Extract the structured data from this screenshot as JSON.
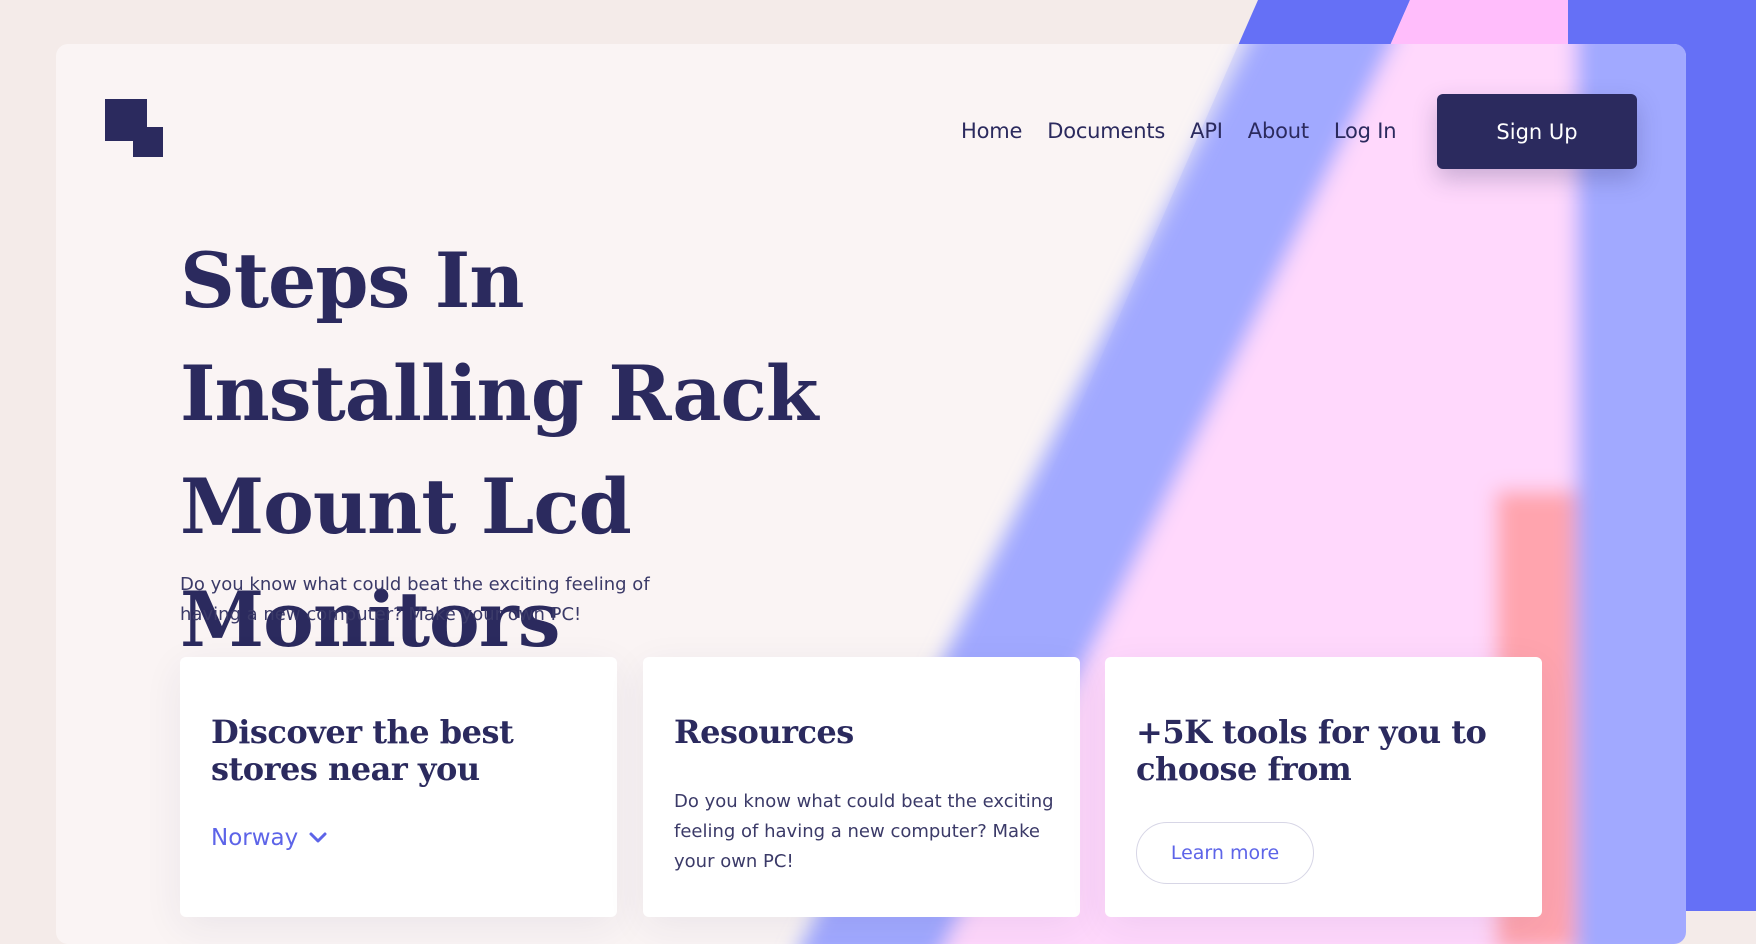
{
  "brand": {
    "logo_icon": "two-squares-logo-icon",
    "color": "#2b2a5e"
  },
  "nav": {
    "items": [
      "Home",
      "Documents",
      "API",
      "About",
      "Log In"
    ],
    "signup_label": "Sign Up"
  },
  "hero": {
    "title": "Steps In Installing Rack Mount Lcd Monitors",
    "subtitle": "Do you know what could beat the exciting feeling of having a new computer? Make your own PC!"
  },
  "cards": [
    {
      "title": "Discover the best stores near you",
      "selected_country": "Norway",
      "dropdown_icon": "chevron-down-icon"
    },
    {
      "title": "Resources",
      "body": "Do you know what could beat the exciting feeling of having a new computer? Make your own PC!"
    },
    {
      "title": "+5K tools for you to choose from",
      "button_label": "Learn more"
    }
  ],
  "colors": {
    "accent": "#5d64e8",
    "primary": "#2b2a5e",
    "stripe_blue": "#6570f6",
    "stripe_pink": "#ffbdfb",
    "stripe_coral": "#ff8f97"
  }
}
